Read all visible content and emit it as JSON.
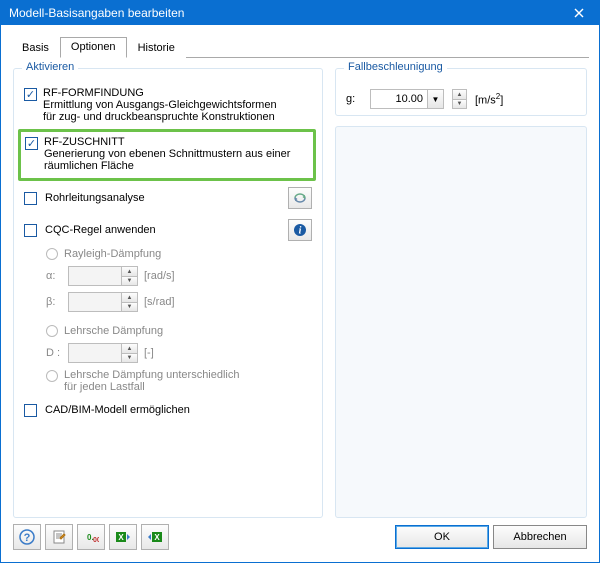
{
  "window": {
    "title": "Modell-Basisangaben bearbeiten"
  },
  "tabs": {
    "basis": "Basis",
    "optionen": "Optionen",
    "historie": "Historie"
  },
  "activate": {
    "title": "Aktivieren",
    "formfindung": {
      "label": "RF-FORMFINDUNG",
      "desc1": "Ermittlung von Ausgangs-Gleichgewichtsformen",
      "desc2": "für zug- und druckbeanspruchte Konstruktionen"
    },
    "zuschnitt": {
      "label": "RF-ZUSCHNITT",
      "desc1": "Generierung von ebenen Schnittmustern aus einer",
      "desc2": "räumlichen Fläche"
    },
    "rohr": {
      "label": "Rohrleitungsanalyse"
    },
    "cqc": {
      "label": "CQC-Regel anwenden"
    },
    "rayleigh": {
      "label": "Rayleigh-Dämpfung"
    },
    "alpha": {
      "label": "α:",
      "unit": "[rad/s]"
    },
    "beta": {
      "label": "β:",
      "unit": "[s/rad]"
    },
    "lehr": {
      "label": "Lehrsche Dämpfung"
    },
    "d": {
      "label": "D :",
      "unit": "[-]"
    },
    "lehr2": {
      "line1": "Lehrsche Dämpfung unterschiedlich",
      "line2": "für jeden Lastfall"
    },
    "cadbim": {
      "label": "CAD/BIM-Modell ermöglichen"
    }
  },
  "fall": {
    "title": "Fallbeschleunigung",
    "g_label": "g:",
    "g_value": "10.00",
    "g_unit_prefix": "[m/s",
    "g_unit_exp": "2",
    "g_unit_suffix": "]"
  },
  "buttons": {
    "ok": "OK",
    "cancel": "Abbrechen"
  },
  "icons": {
    "info_glyph": "ℹ",
    "help_glyph": "?",
    "edit_glyph": "✎",
    "gear_glyph": "⚙"
  }
}
